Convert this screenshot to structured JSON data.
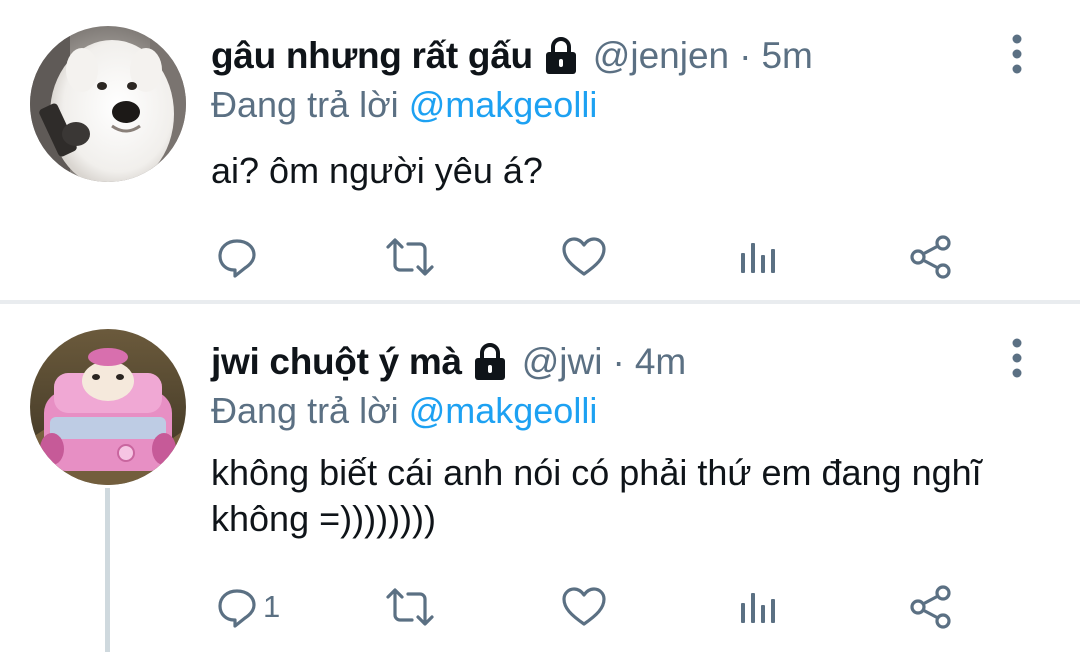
{
  "tweets": [
    {
      "display_name": "gâu nhưng rất gấu",
      "handle": "@jenjen",
      "separator": "·",
      "time": "5m",
      "replying_prefix": "Đang trả lời",
      "replying_to": "@makgeolli",
      "text": "ai? ôm người yêu á?",
      "reply_count": "",
      "avatar": "white-dog-with-microphone",
      "protected": true
    },
    {
      "display_name": "jwi chuột ý mà",
      "handle": "@jwi",
      "separator": "·",
      "time": "4m",
      "replying_prefix": "Đang trả lời",
      "replying_to": "@makgeolli",
      "text": "không biết cái anh nói có phải thứ em đang nghĩ không =))))))))",
      "reply_count": "1",
      "avatar": "hamster-in-pink-toy-car",
      "protected": true
    }
  ],
  "icons": {
    "reply": "reply-icon",
    "retweet": "retweet-icon",
    "like": "heart-icon",
    "analytics": "analytics-icon",
    "share": "share-icon",
    "more": "more-vertical-icon",
    "lock": "lock-icon"
  },
  "colors": {
    "text": "#0f1419",
    "secondary": "#5b7083",
    "mention": "#1da1f2",
    "divider": "#e9ecef",
    "thread_line": "#cfd9de"
  }
}
